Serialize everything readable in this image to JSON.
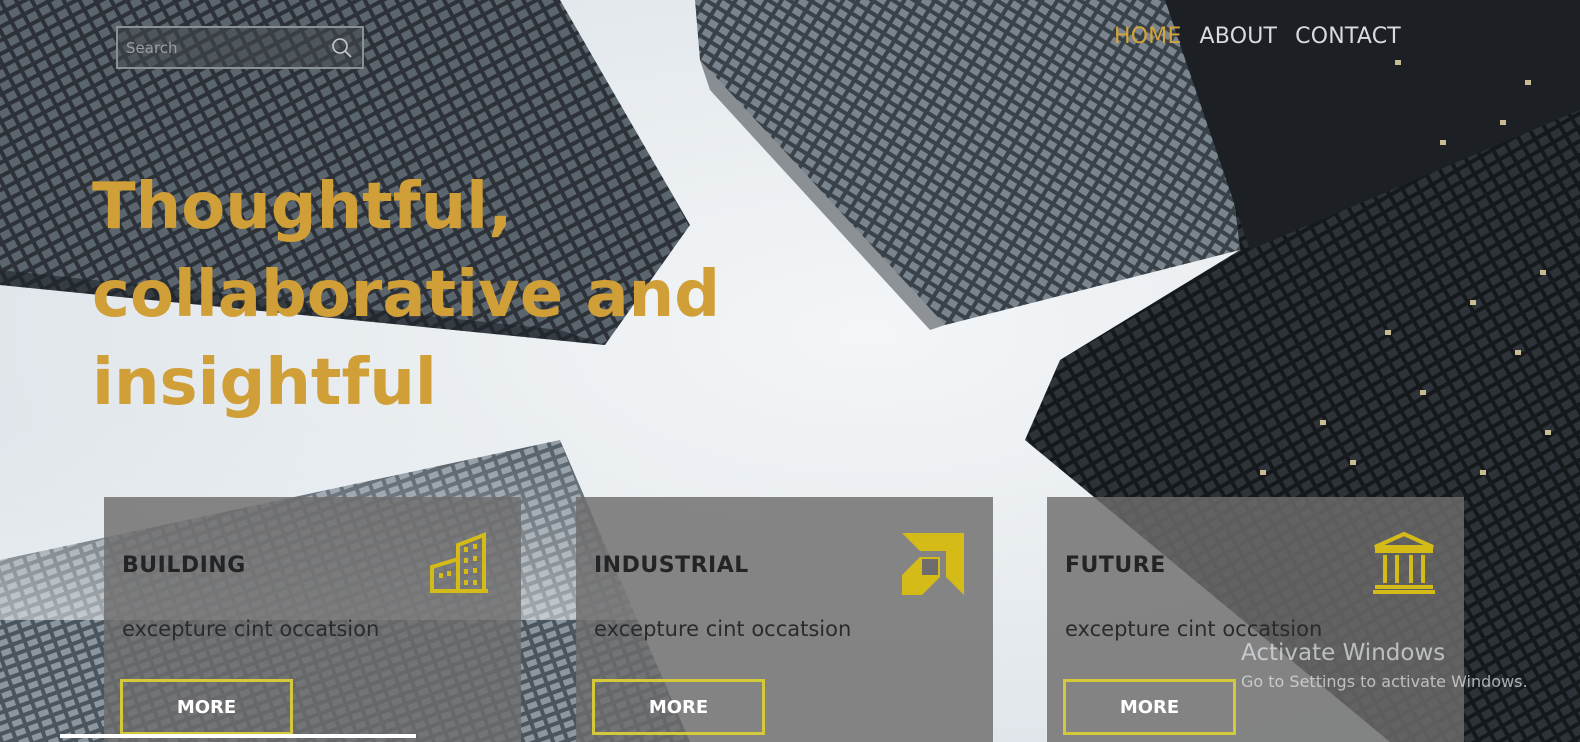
{
  "search": {
    "placeholder": "Search"
  },
  "nav": {
    "items": [
      {
        "label": "HOME",
        "active": true
      },
      {
        "label": "ABOUT",
        "active": false
      },
      {
        "label": "CONTACT",
        "active": false
      }
    ]
  },
  "hero": {
    "line1": "Thoughtful,",
    "line2": "collaborative and",
    "line3": "insightful"
  },
  "cards": [
    {
      "title": "BUILDING",
      "description": "excepture cint occatsion",
      "button": "MORE",
      "icon": "building-icon"
    },
    {
      "title": "INDUSTRIAL",
      "description": "excepture cint occatsion",
      "button": "MORE",
      "icon": "amd-logo-icon"
    },
    {
      "title": "FUTURE",
      "description": "excepture cint occatsion",
      "button": "MORE",
      "icon": "bank-icon"
    }
  ],
  "watermark": {
    "title": "Activate Windows",
    "subtitle": "Go to Settings to activate Windows."
  },
  "colors": {
    "accent": "#d09f37",
    "icon_yellow": "#d4bb17",
    "button_border": "#d3c93a",
    "card_bg": "#6e6c6c"
  }
}
